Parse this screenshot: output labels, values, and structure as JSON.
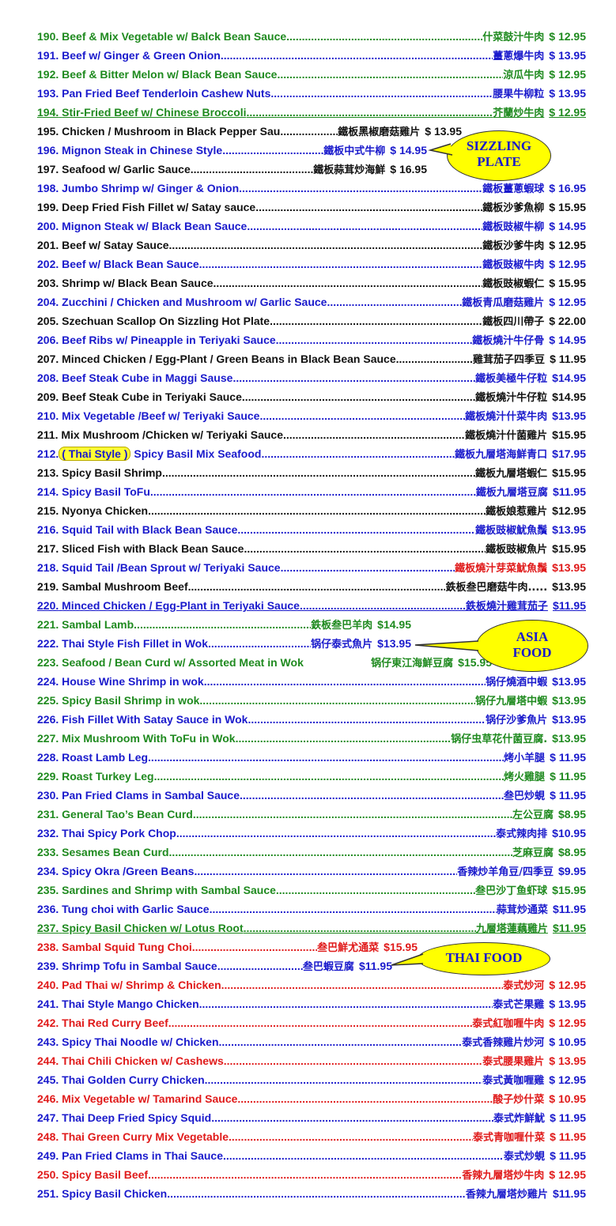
{
  "items": [
    {
      "num": "190.",
      "name": "Beef & Mix Vegetable w/ Balck Bean Sauce",
      "chinese": "什菜鼓汁牛肉",
      "price": "$ 12.95",
      "color": "green"
    },
    {
      "num": "191.",
      "name": "Beef w/ Ginger & Green Onion",
      "chinese": "薑蔥爆牛肉",
      "price": "$ 13.95",
      "color": "blue"
    },
    {
      "num": "192.",
      "name": "Beef & Bitter Melon w/ Black Bean Sauce",
      "chinese": "涼瓜牛肉",
      "price": "$ 12.95",
      "color": "green"
    },
    {
      "num": "193.",
      "name": "Pan Fried Beef Tenderloin Cashew Nuts",
      "chinese": "腰果牛柳粒",
      "price": "$ 13.95",
      "color": "blue"
    },
    {
      "num": "194.",
      "name": "Stir-Fried Beef w/ Chinese Broccoli",
      "chinese": "芥蘭炒牛肉",
      "price": "$ 12.95",
      "color": "green",
      "underline": true
    },
    {
      "num": "195.",
      "name": "Chicken / Mushroom in Black Pepper Sau.",
      "chinese": "鐵板黑椒磨菇雞片",
      "price": "$ 13.95",
      "color": "black",
      "short": true
    },
    {
      "num": "196.",
      "name": "Mignon Steak in Chinese Style",
      "chinese": "鐵板中式牛柳",
      "price": "$ 14.95",
      "color": "blue",
      "short": true
    },
    {
      "num": "197.",
      "name": "Seafood w/ Garlic Sauce",
      "chinese": "鐵板蒜茸炒海鮮",
      "price": "$ 16.95",
      "color": "black",
      "short": true
    },
    {
      "num": "198.",
      "name": "Jumbo Shrimp w/ Ginger & Onion",
      "chinese": "鐵板薑蔥蝦球",
      "price": "$ 16.95",
      "color": "blue"
    },
    {
      "num": "199.",
      "name": "Deep Fried Fish Fillet w/ Satay sauce",
      "chinese": "鐵板沙爹魚柳",
      "price": "$ 15.95",
      "color": "black"
    },
    {
      "num": "200.",
      "name": "Mignon Steak w/ Black Bean Sauce",
      "chinese": "鐵板豉椒牛柳",
      "price": "$ 14.95",
      "color": "blue"
    },
    {
      "num": "201.",
      "name": "Beef w/ Satay Sauce",
      "chinese": "鐵板沙爹牛肉",
      "price": "$ 12.95",
      "color": "black"
    },
    {
      "num": "202.",
      "name": "Beef w/ Black Bean Sauce",
      "chinese": "鐵板豉椒牛肉",
      "price": "$ 12.95",
      "color": "blue"
    },
    {
      "num": "203.",
      "name": "Shrimp w/ Black Bean Sauce",
      "chinese": "鐵板豉椒蝦仁",
      "price": "$ 15.95",
      "color": "black"
    },
    {
      "num": "204.",
      "name": "Zucchini / Chicken and Mushroom w/ Garlic Sauce",
      "chinese": "鐵板青瓜磨菇雞片",
      "price": "$ 12.95",
      "color": "blue"
    },
    {
      "num": "205.",
      "name": "Szechuan Scallop On Sizzling Hot Plate",
      "chinese": "鐵板四川帶子",
      "price": "$ 22.00",
      "color": "black"
    },
    {
      "num": "206.",
      "name": "Beef Ribs w/ Pineapple in Teriyaki Sauce",
      "chinese": "鐵板燒汁牛仔骨",
      "price": "$ 14.95",
      "color": "blue"
    },
    {
      "num": "207.",
      "name": "Minced Chicken / Egg-Plant / Green Beans in Black Bean Sauce",
      "chinese": "雞茸茄子四季豆",
      "price": "$ 11.95",
      "color": "black"
    },
    {
      "num": "208.",
      "name": "Beef Steak Cube in Maggi Sause",
      "chinese": "鐵板美極牛仔粒",
      "price": "$14.95",
      "color": "blue"
    },
    {
      "num": "209.",
      "name": "Beef Steak Cube in Teriyaki Sauce",
      "chinese": "鐵板燒汁牛仔粒",
      "price": "$14.95",
      "color": "black"
    },
    {
      "num": "210.",
      "name": "Mix Vegetable /Beef w/ Teriyaki Sauce",
      "chinese": "鐵板燒汁什菜牛肉",
      "price": "$13.95",
      "color": "blue"
    },
    {
      "num": "211.",
      "name": "Mix Mushroom /Chicken    w/ Teriyaki Sauce",
      "chinese": "鐵板燒汁什菌雞片",
      "price": "$15.95",
      "color": "black"
    },
    {
      "num": "212.",
      "tag": "( Thai Style )",
      "name": "Spicy Basil Mix Seafood",
      "chinese": "鐵板九層塔海鮮青口",
      "price": "$17.95",
      "color": "blue"
    },
    {
      "num": "213.",
      "name": "Spicy Basil Shrimp",
      "chinese": "鐵板九層塔蝦仁",
      "price": "$15.95",
      "color": "black"
    },
    {
      "num": "214.",
      "name": "Spicy Basil ToFu",
      "chinese": "鐵板九層塔豆腐",
      "price": "$11.95",
      "color": "blue"
    },
    {
      "num": "215.",
      "name": "Nyonya Chicken",
      "chinese": "鐵板娘惹雞片",
      "price": "$12.95",
      "color": "black"
    },
    {
      "num": "216.",
      "name": "Squid Tail with Black Bean Sauce",
      "chinese": "鐵板豉椒魷魚鬚",
      "price": "$13.95",
      "color": "blue"
    },
    {
      "num": "217.",
      "name": "Sliced Fish with Black Bean Sauce",
      "chinese": "鐵板豉椒魚片",
      "price": "$15.95",
      "color": "black"
    },
    {
      "num": "218.",
      "name": "Squid Tail /Bean Sprout w/ Teriyaki Sauce",
      "chinese": "鐵板燒汁芽菜魷魚鬚",
      "price": "$13.95",
      "color": "blue",
      "cnColor": "red"
    },
    {
      "num": "219.",
      "name": "Sambal Mushroom Beef",
      "chinese": "鉄板叁巴磨菇牛肉.....",
      "price": "$13.95",
      "color": "black"
    },
    {
      "num": "220.",
      "name": "Minced Chicken / Egg-Plant in Teriyaki Sauce",
      "chinese": "鉄板燒汁雞茸茄子",
      "price": "$11.95",
      "color": "blue",
      "underline": true
    },
    {
      "num": "221.",
      "name": "Sambal Lamb",
      "chinese": "鉄板叁巴羊肉",
      "price": "$14.95",
      "color": "green",
      "short": true
    },
    {
      "num": "222.",
      "name": "Thai Style Fish Fillet in Wok",
      "chinese": "锅仔泰式魚片",
      "price": "$13.95",
      "color": "blue",
      "short": true
    },
    {
      "num": "223.",
      "name": "Seafood / Bean Curd w/ Assorted Meat in Wok",
      "chinese": "锅仔東江海鮮豆腐",
      "price": "$15.95",
      "color": "green",
      "short": true,
      "nodots": true
    },
    {
      "num": "224.",
      "name": "House Wine Shrimp in wok",
      "chinese": "锅仔燒酒中蝦",
      "price": "$13.95",
      "color": "blue"
    },
    {
      "num": "225.",
      "name": "Spicy Basil Shrimp in wok",
      "chinese": "锅仔九層塔中蝦",
      "price": "$13.95",
      "color": "green"
    },
    {
      "num": "226.",
      "name": "Fish Fillet With Satay Sauce in Wok",
      "chinese": "锅仔沙爹魚片",
      "price": "$13.95",
      "color": "blue"
    },
    {
      "num": "227.",
      "name": "Mix Mushroom With ToFu in Wok",
      "chinese": "锅仔虫草花什菌豆腐.",
      "price": "$13.95",
      "color": "green"
    },
    {
      "num": "228.",
      "name": "Roast Lamb Leg",
      "chinese": "烤小羊腿",
      "price": "$ 11.95",
      "color": "blue"
    },
    {
      "num": "229.",
      "name": "Roast Turkey Leg",
      "chinese": "烤火雞腿",
      "price": "$ 11.95",
      "color": "green"
    },
    {
      "num": "230.",
      "name": "Pan Fried Clams in Sambal Sauce",
      "chinese": "叁巴炒蜆",
      "price": "$ 11.95",
      "color": "blue"
    },
    {
      "num": "231.",
      "name": "General Tao’s Bean Curd",
      "chinese": "左公豆腐",
      "price": "$8.95",
      "color": "green"
    },
    {
      "num": "232.",
      "name": "Thai Spicy Pork Chop",
      "chinese": "泰式辣肉排",
      "price": "$10.95",
      "color": "blue"
    },
    {
      "num": "233.",
      "name": "Sesames Bean Curd",
      "chinese": "芝麻豆腐",
      "price": "$8.95",
      "color": "green"
    },
    {
      "num": "234.",
      "name": "Spicy Okra /Green Beans",
      "chinese": "香辣炒羊角豆/四季豆",
      "price": "$9.95",
      "color": "blue"
    },
    {
      "num": "235.",
      "name": "Sardines and Shrimp with Sambal Sauce",
      "chinese": "叁巴沙丁鱼虾球",
      "price": "$15.95",
      "color": "green"
    },
    {
      "num": "236.",
      "name": "Tung choi with Garlic Sauce",
      "chinese": "蒜茸炒通菜",
      "price": "$11.95",
      "color": "blue"
    },
    {
      "num": "237.",
      "name": "Spicy Basil Chicken w/ Lotus Root",
      "chinese": "九層塔蓮藕雞片",
      "price": "$11.95",
      "color": "green",
      "underline": true
    },
    {
      "num": "238.",
      "name": "Sambal Squid Tung Choi",
      "chinese": "叁巴鮮尤通菜",
      "price": "$15.95",
      "color": "red",
      "short": true
    },
    {
      "num": "239.",
      "name": "Shrimp Tofu in Sambal Sauce",
      "chinese": "叁巴蝦豆腐",
      "price": "$11.95",
      "color": "blue",
      "short": true
    },
    {
      "num": "240.",
      "name": "Pad Thai w/ Shrimp & Chicken",
      "chinese": "泰式炒河",
      "price": "$ 12.95",
      "color": "red"
    },
    {
      "num": "241.",
      "name": "Thai Style Mango Chicken",
      "chinese": "泰式芒果雞",
      "price": "$ 13.95",
      "color": "blue"
    },
    {
      "num": "242.",
      "name": "Thai Red Curry Beef",
      "chinese": "泰式紅咖喱牛肉",
      "price": "$ 12.95",
      "color": "red"
    },
    {
      "num": "243.",
      "name": "Spicy Thai Noodle w/ Chicken",
      "chinese": "泰式香辣雞片炒河",
      "price": "$ 10.95",
      "color": "blue"
    },
    {
      "num": "244.",
      "name": "Thai Chili Chicken w/ Cashews",
      "chinese": "泰式腰果雞片",
      "price": "$ 13.95",
      "color": "red"
    },
    {
      "num": "245.",
      "name": "Thai Golden Curry Chicken",
      "chinese": "泰式黃咖喱雞",
      "price": "$ 12.95",
      "color": "blue"
    },
    {
      "num": "246.",
      "name": "Mix Vegetable w/ Tamarind Sauce",
      "chinese": "酸子炒什菜",
      "price": "$ 10.95",
      "color": "red"
    },
    {
      "num": "247.",
      "name": "Thai Deep Fried Spicy Squid",
      "chinese": "泰式炸鮮魷",
      "price": "$ 11.95",
      "color": "blue"
    },
    {
      "num": "248.",
      "name": "Thai Green Curry Mix Vegetable",
      "chinese": "泰式青咖喱什菜",
      "price": "$ 11.95",
      "color": "red"
    },
    {
      "num": "249.",
      "name": "Pan Fried Clams in Thai Sauce",
      "chinese": "泰式炒蜆",
      "price": "$ 11.95",
      "color": "blue"
    },
    {
      "num": "250.",
      "name": "Spicy Basil Beef",
      "chinese": "香辣九層塔炒牛肉",
      "price": "$ 12.95",
      "color": "red"
    },
    {
      "num": "251.",
      "name": "Spicy Basil Chicken",
      "chinese": "香辣九層塔炒雞片",
      "price": "$11.95",
      "color": "blue"
    }
  ],
  "callouts": {
    "sizzling": [
      "SIZZLING",
      "PLATE"
    ],
    "asia": [
      "ASIA",
      "FOOD"
    ],
    "thai": [
      "THAI FOOD"
    ]
  },
  "colors": {
    "green": "#1f8a1f",
    "blue": "#1a1acc",
    "black": "#111111",
    "red": "#e01a1a",
    "callout_fill": "#ffff00"
  }
}
